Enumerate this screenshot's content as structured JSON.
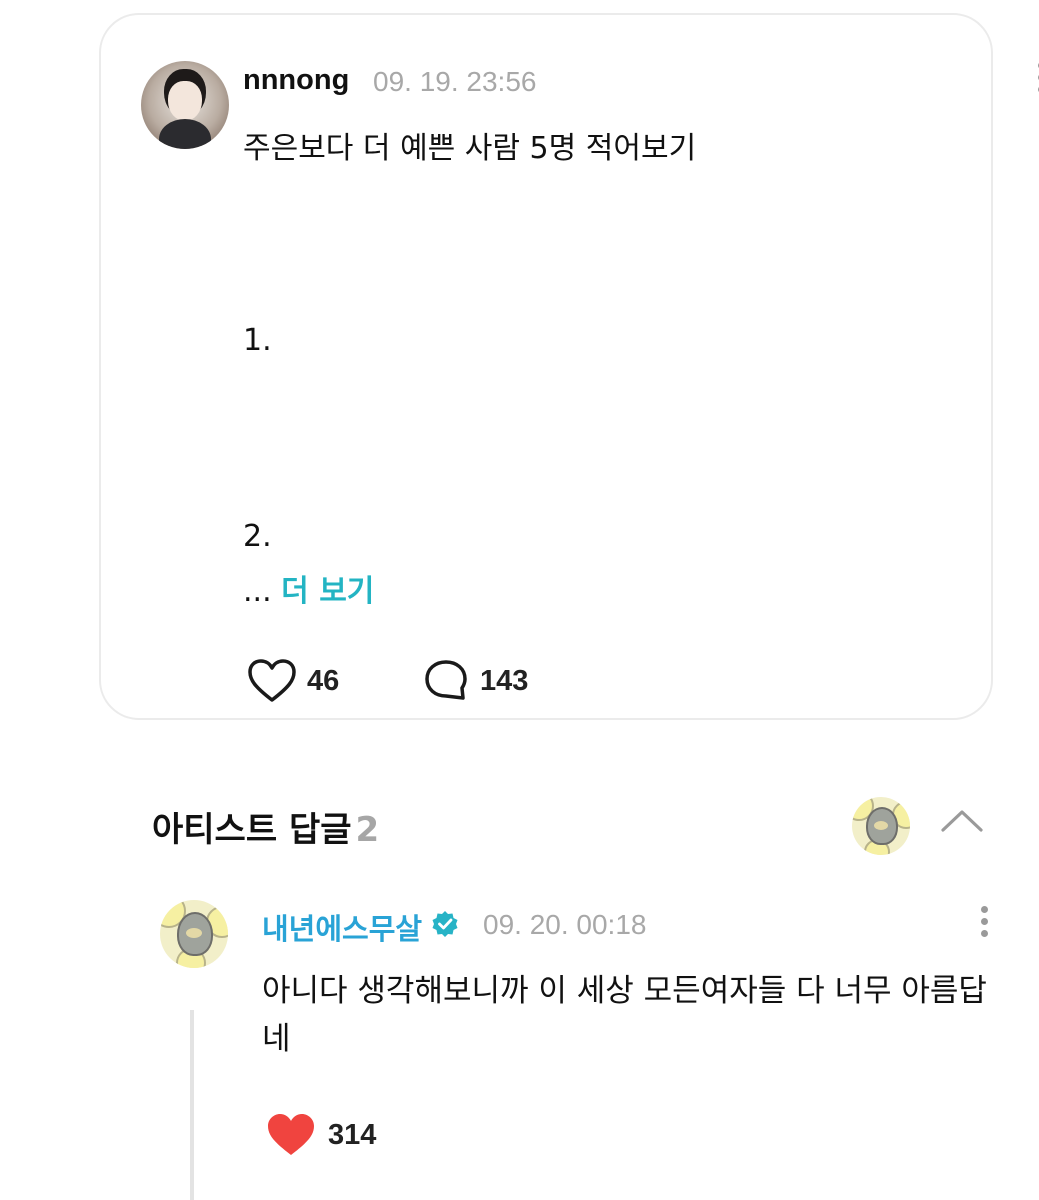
{
  "post": {
    "username": "nnnong",
    "timestamp": "09. 19. 23:56",
    "body_lines": [
      "주은보다 더 예쁜 사람 5명 적어보기",
      "1.",
      "2."
    ],
    "ellipsis": "...",
    "more_label": "더 보기",
    "likes": "46",
    "comments": "143",
    "icons": {
      "avatar": "user-photo-avatar",
      "menu": "kebab-menu-icon",
      "like": "heart-outline-icon",
      "comment": "speech-bubble-icon"
    }
  },
  "artist_replies": {
    "title": "아티스트 답글",
    "count": "2",
    "icons": {
      "avatar": "duck-avatar",
      "toggle": "chevron-up-icon"
    },
    "reply": {
      "author": "내년에스무살",
      "timestamp": "09. 20. 00:18",
      "text": "아니다 생각해보니까 이 세상 모든여자들 다 너무 아름답네",
      "likes": "314",
      "icons": {
        "verified": "verified-badge-icon",
        "like": "heart-filled-icon",
        "menu": "kebab-menu-icon"
      }
    }
  },
  "colors": {
    "accent": "#23b4c3",
    "artist_name": "#29a3d6",
    "heart": "#f0443f",
    "muted": "#a8a8a8"
  }
}
